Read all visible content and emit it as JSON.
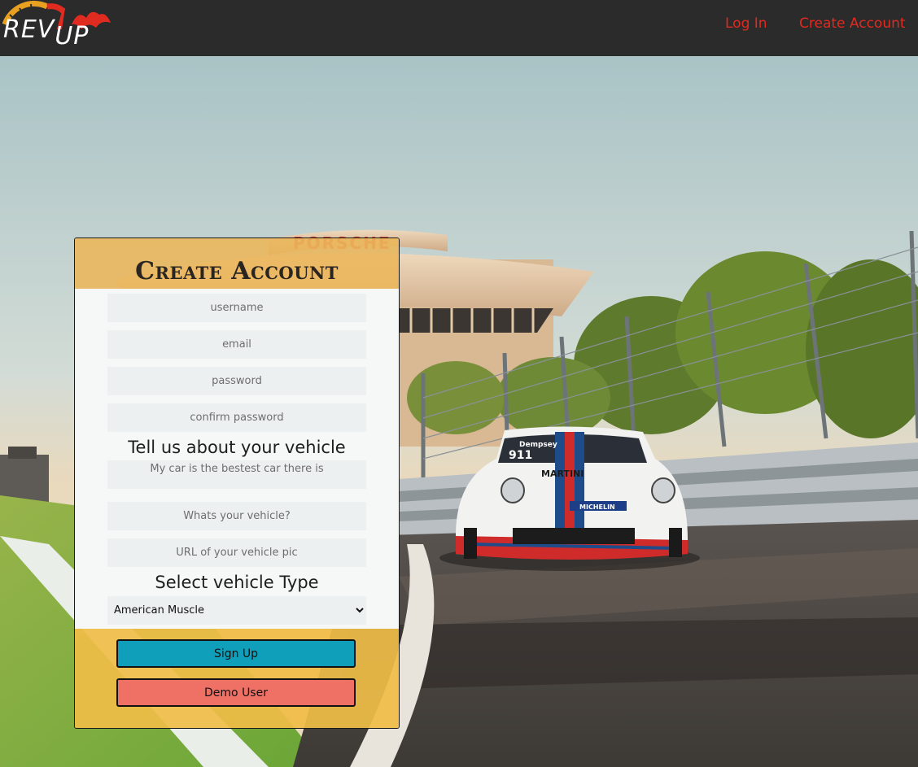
{
  "brand": {
    "rev": "REV",
    "up": "UP",
    "colors": {
      "accent": "#e02b20",
      "gauge": "#e8a020"
    }
  },
  "nav": {
    "login_label": "Log In",
    "create_account_label": "Create Account"
  },
  "form": {
    "title": "Create Account",
    "fields": {
      "username_placeholder": "username",
      "email_placeholder": "email",
      "password_placeholder": "password",
      "confirm_password_placeholder": "confirm password",
      "bio_placeholder": "My car is the bestest car there is",
      "vehicle_placeholder": "Whats your vehicle?",
      "vehicle_pic_placeholder": "URL of your vehicle pic"
    },
    "vehicle_section_label": "Tell us about your vehicle",
    "vehicle_type_label": "Select vehicle Type",
    "vehicle_type_selected": "American Muscle",
    "signup_label": "Sign Up",
    "demo_label": "Demo User"
  },
  "background": {
    "building_sign": "PORSCHE",
    "car_livery": "MARTINI",
    "car_name": "Dempsey",
    "car_model": "911",
    "tire_brand": "MICHELIN"
  }
}
